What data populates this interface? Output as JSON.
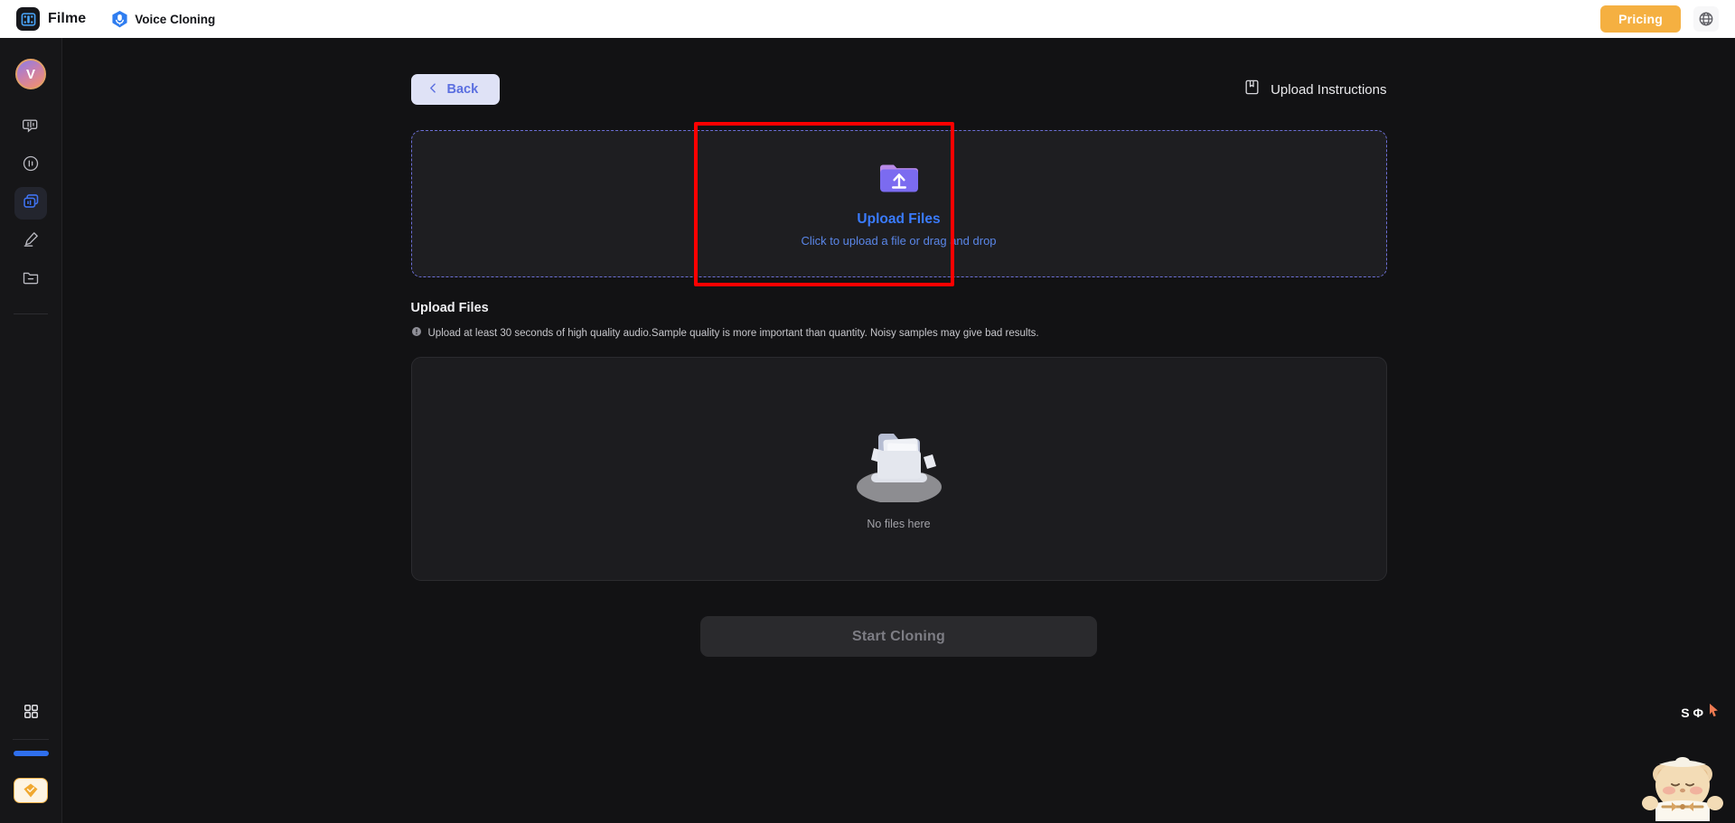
{
  "topbar": {
    "brand_name": "Filme",
    "brand_logo_icon": "film-strip-icon",
    "product_name": "Voice Cloning",
    "product_icon": "microphone-badge-icon",
    "pricing_label": "Pricing",
    "pricing_color": "#f5b041",
    "language_icon": "globe-icon"
  },
  "sidebar": {
    "avatar_initial": "V",
    "items": [
      {
        "name": "text-to-speech",
        "icon": "speech-bubble-icon",
        "active": false
      },
      {
        "name": "voice-changer",
        "icon": "audio-circle-icon",
        "active": false
      },
      {
        "name": "voice-cloning",
        "icon": "stacked-cards-icon",
        "active": true
      },
      {
        "name": "voice-recorder",
        "icon": "microphone-pen-icon",
        "active": false
      },
      {
        "name": "my-files",
        "icon": "folder-minus-icon",
        "active": false
      }
    ],
    "apps_icon": "grid-apps-icon",
    "progress_bar_color": "#2f6fed",
    "gem_icon": "diamond-gem-icon"
  },
  "main": {
    "back_label": "Back",
    "back_icon": "chevron-left-icon",
    "upload_instructions_label": "Upload Instructions",
    "upload_instructions_icon": "book-icon",
    "dropzone": {
      "icon": "folder-upload-icon",
      "title": "Upload Files",
      "subtitle": "Click to upload a file or drag and drop",
      "title_color": "#3a7bfd",
      "highlight_color": "#ff0000"
    },
    "section_title": "Upload Files",
    "hint_icon": "info-circle-icon",
    "hint_text": "Upload at least 30 seconds of high quality audio.Sample quality is more important than quantity. Noisy samples may give bad results.",
    "filelist": {
      "empty_icon": "empty-folder-illustration",
      "empty_caption": "No files here"
    },
    "start_button_label": "Start Cloning",
    "start_button_enabled": false
  },
  "overlay": {
    "tool_glyphs": "S Φ",
    "tool_icon": "orange-cursor-icon",
    "mascot_icon": "bear-chef-mascot"
  }
}
